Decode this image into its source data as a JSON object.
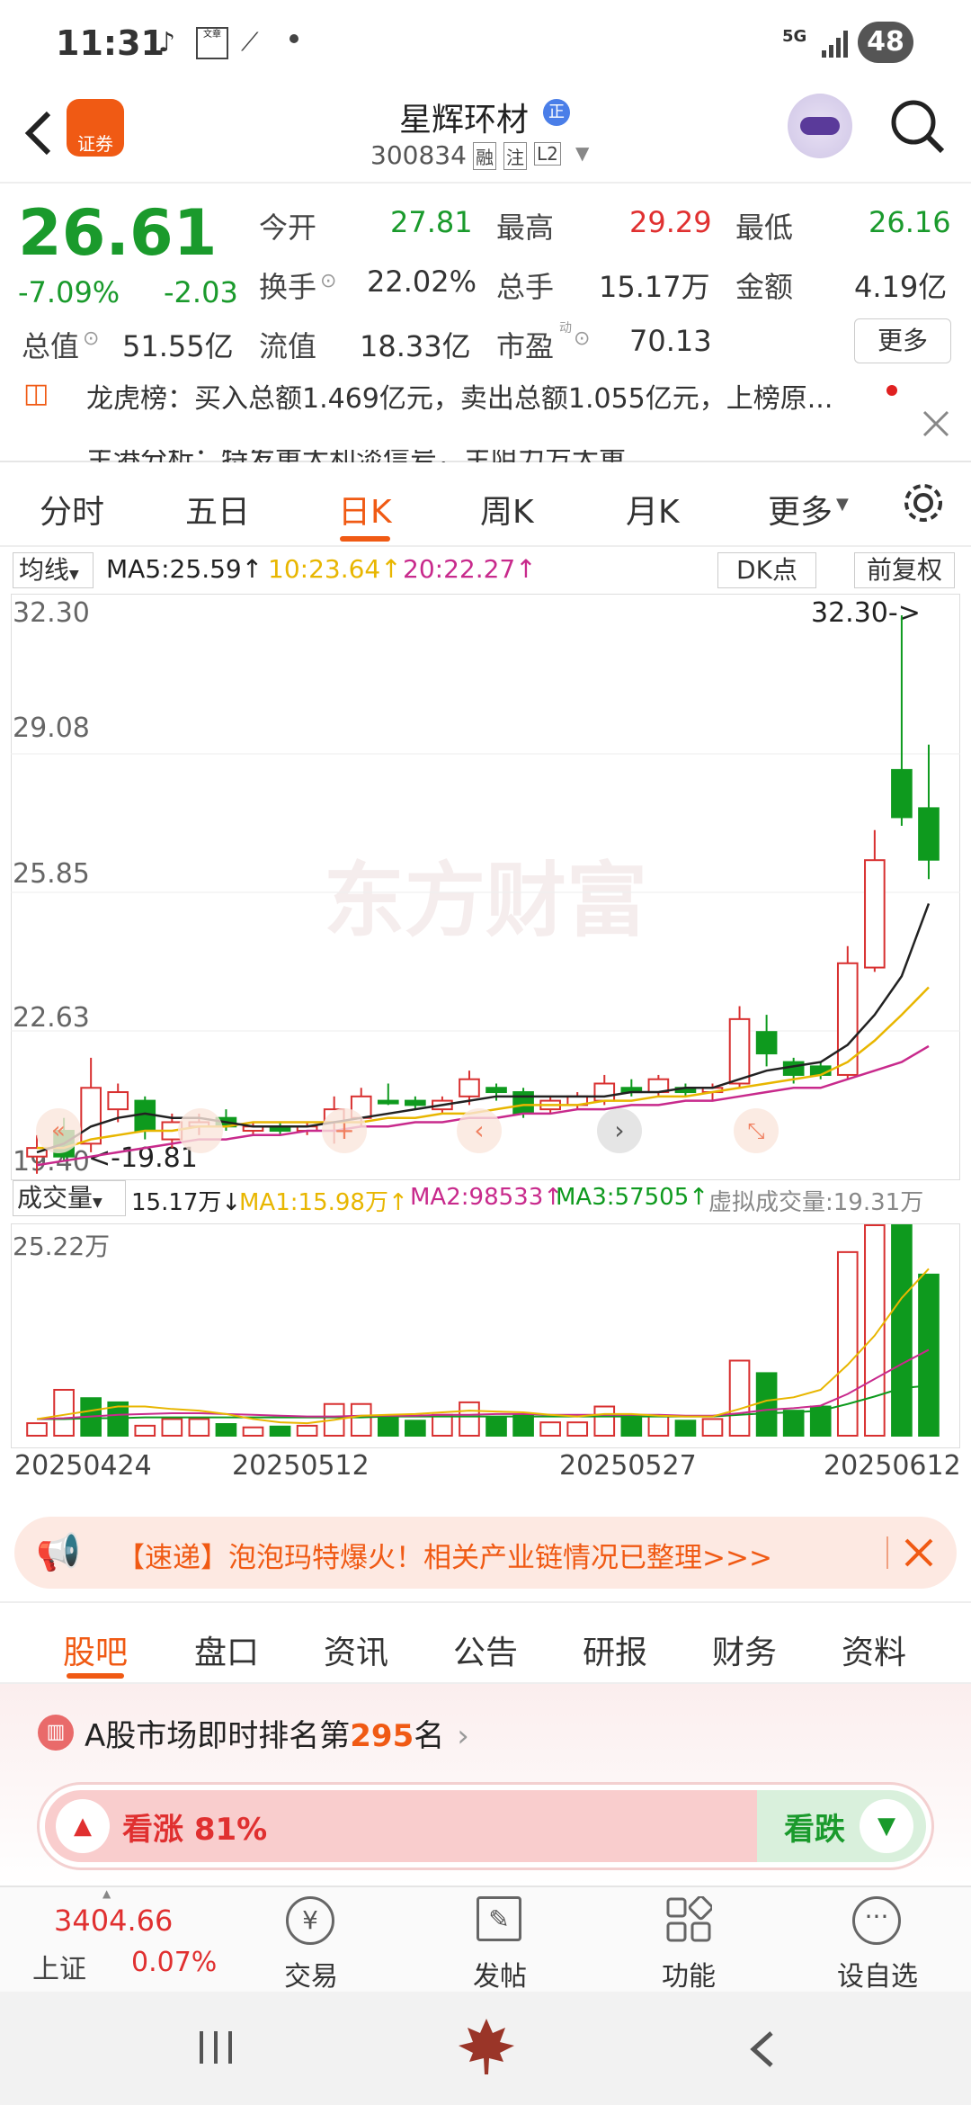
{
  "status_bar": {
    "time": "11:31",
    "network": "5G",
    "battery": "48"
  },
  "header": {
    "logo_label": "证券",
    "stock_name": "星辉环材",
    "stock_code": "300834",
    "tags": [
      "融",
      "注",
      "L2"
    ],
    "badge": "正"
  },
  "quote": {
    "price": "26.61",
    "change_pct": "-7.09%",
    "change_abs": "-2.03",
    "open_label": "今开",
    "open": "27.81",
    "high_label": "最高",
    "high": "29.29",
    "low_label": "最低",
    "low": "26.16",
    "turnover_label": "换手",
    "turnover": "22.02%",
    "volume_label": "总手",
    "volume": "15.17万",
    "amount_label": "金额",
    "amount": "4.19亿",
    "mktcap_label": "总值",
    "mktcap": "51.55亿",
    "float_label": "流值",
    "float_cap": "18.33亿",
    "pe_label": "市盈",
    "pe_sup": "动",
    "pe": "70.13",
    "more_label": "更多"
  },
  "news": {
    "dragon_tiger": "龙虎榜：买入总额1.469亿元，卖出总额1.055亿元，上榜原...",
    "second_line": "主港分析：特发重大利淡信号，主阻力方大重"
  },
  "kline_tabs": {
    "items": [
      "分时",
      "五日",
      "日K",
      "周K",
      "月K",
      "更多"
    ],
    "active": "日K"
  },
  "chart_toolbar": {
    "ma_select": "均线",
    "ma5": "MA5:25.59↑",
    "ma10": "10:23.64↑",
    "ma20": "20:22.27↑",
    "dk_button": "DK点",
    "adjust_button": "前复权"
  },
  "chart_data": {
    "type": "candlestick",
    "price_ticks": [
      "32.30",
      "29.08",
      "25.85",
      "22.63",
      "19.40"
    ],
    "ylim": [
      19.4,
      32.3
    ],
    "max_annotation": "32.30->",
    "min_annotation": "<-19.81",
    "watermark": "东方财富",
    "x_tick_labels": [
      "20250424",
      "20250512",
      "20250527",
      "20250612"
    ],
    "candles": [
      {
        "o": 19.9,
        "c": 19.7,
        "h": 20.2,
        "l": 19.3,
        "up": true
      },
      {
        "o": 19.7,
        "c": 20.3,
        "h": 20.6,
        "l": 19.6,
        "up": false
      },
      {
        "o": 20.0,
        "c": 21.3,
        "h": 22.0,
        "l": 19.8,
        "up": true
      },
      {
        "o": 20.8,
        "c": 21.2,
        "h": 21.4,
        "l": 20.5,
        "up": true
      },
      {
        "o": 21.0,
        "c": 20.3,
        "h": 21.1,
        "l": 20.1,
        "up": false
      },
      {
        "o": 20.1,
        "c": 20.5,
        "h": 20.7,
        "l": 19.9,
        "up": true
      },
      {
        "o": 20.4,
        "c": 20.5,
        "h": 20.7,
        "l": 20.2,
        "up": true
      },
      {
        "o": 20.6,
        "c": 20.4,
        "h": 20.8,
        "l": 20.3,
        "up": false
      },
      {
        "o": 20.3,
        "c": 20.4,
        "h": 20.5,
        "l": 20.2,
        "up": true
      },
      {
        "o": 20.4,
        "c": 20.3,
        "h": 20.5,
        "l": 20.2,
        "up": false
      },
      {
        "o": 20.3,
        "c": 20.4,
        "h": 20.5,
        "l": 20.2,
        "up": true
      },
      {
        "o": 20.5,
        "c": 20.8,
        "h": 21.1,
        "l": 20.0,
        "up": true
      },
      {
        "o": 20.6,
        "c": 21.1,
        "h": 21.3,
        "l": 20.4,
        "up": true
      },
      {
        "o": 21.0,
        "c": 21.0,
        "h": 21.4,
        "l": 20.9,
        "up": false
      },
      {
        "o": 21.0,
        "c": 20.9,
        "h": 21.1,
        "l": 20.8,
        "up": false
      },
      {
        "o": 20.8,
        "c": 21.0,
        "h": 21.1,
        "l": 20.7,
        "up": true
      },
      {
        "o": 21.1,
        "c": 21.5,
        "h": 21.7,
        "l": 20.9,
        "up": true
      },
      {
        "o": 21.3,
        "c": 21.2,
        "h": 21.4,
        "l": 21.0,
        "up": false
      },
      {
        "o": 21.2,
        "c": 20.7,
        "h": 21.3,
        "l": 20.6,
        "up": false
      },
      {
        "o": 20.8,
        "c": 21.0,
        "h": 21.1,
        "l": 20.7,
        "up": true
      },
      {
        "o": 20.9,
        "c": 21.1,
        "h": 21.2,
        "l": 20.8,
        "up": true
      },
      {
        "o": 21.0,
        "c": 21.4,
        "h": 21.6,
        "l": 20.9,
        "up": true
      },
      {
        "o": 21.3,
        "c": 21.2,
        "h": 21.5,
        "l": 21.1,
        "up": false
      },
      {
        "o": 21.2,
        "c": 21.5,
        "h": 21.6,
        "l": 21.1,
        "up": true
      },
      {
        "o": 21.3,
        "c": 21.2,
        "h": 21.4,
        "l": 21.1,
        "up": false
      },
      {
        "o": 21.2,
        "c": 21.3,
        "h": 21.4,
        "l": 21.0,
        "up": true
      },
      {
        "o": 21.4,
        "c": 22.9,
        "h": 23.2,
        "l": 21.3,
        "up": true
      },
      {
        "o": 22.6,
        "c": 22.1,
        "h": 23.0,
        "l": 21.8,
        "up": false
      },
      {
        "o": 21.9,
        "c": 21.6,
        "h": 22.0,
        "l": 21.4,
        "up": false
      },
      {
        "o": 21.6,
        "c": 21.8,
        "h": 21.9,
        "l": 21.5,
        "up": false
      },
      {
        "o": 21.6,
        "c": 24.2,
        "h": 24.6,
        "l": 21.5,
        "up": true
      },
      {
        "o": 24.1,
        "c": 26.6,
        "h": 27.3,
        "l": 24.0,
        "up": true
      },
      {
        "o": 28.7,
        "c": 27.6,
        "h": 32.3,
        "l": 27.4,
        "up": false
      },
      {
        "o": 27.81,
        "c": 26.61,
        "h": 29.29,
        "l": 26.16,
        "up": false
      }
    ],
    "ma5": [
      19.8,
      20.0,
      20.4,
      20.6,
      20.7,
      20.6,
      20.6,
      20.5,
      20.4,
      20.4,
      20.4,
      20.5,
      20.6,
      20.7,
      20.8,
      20.9,
      21.0,
      21.1,
      21.1,
      21.1,
      21.1,
      21.1,
      21.2,
      21.2,
      21.3,
      21.3,
      21.5,
      21.7,
      21.8,
      21.9,
      22.3,
      23.0,
      23.9,
      25.59
    ],
    "ma10": [
      19.9,
      19.9,
      20.1,
      20.2,
      20.3,
      20.3,
      20.4,
      20.4,
      20.5,
      20.5,
      20.5,
      20.5,
      20.5,
      20.6,
      20.6,
      20.7,
      20.7,
      20.8,
      20.9,
      20.9,
      20.9,
      21.0,
      21.0,
      21.1,
      21.1,
      21.2,
      21.3,
      21.4,
      21.5,
      21.6,
      21.9,
      22.4,
      23.0,
      23.64
    ],
    "ma20": [
      19.5,
      19.6,
      19.7,
      19.8,
      19.9,
      20.0,
      20.1,
      20.1,
      20.2,
      20.2,
      20.3,
      20.3,
      20.4,
      20.4,
      20.5,
      20.5,
      20.6,
      20.6,
      20.7,
      20.7,
      20.8,
      20.8,
      20.9,
      20.9,
      21.0,
      21.0,
      21.1,
      21.2,
      21.3,
      21.3,
      21.5,
      21.7,
      21.9,
      22.27
    ]
  },
  "volume": {
    "select_label": "成交量",
    "vol_value": "15.17万↓",
    "ma1": "MA1:15.98万↑",
    "ma2": "MA2:98533↑",
    "ma3": "MA3:57505↑",
    "virtual": "虚拟成交量:19.31万",
    "top_tick": "25.22万",
    "ylim": [
      0,
      25.22
    ],
    "bars": [
      1.5,
      5.5,
      4.5,
      4.0,
      1.2,
      2.0,
      2.0,
      1.4,
      1.0,
      1.1,
      1.2,
      3.8,
      3.8,
      2.3,
      1.8,
      2.5,
      4.0,
      2.2,
      2.5,
      1.6,
      1.6,
      3.5,
      2.3,
      2.4,
      1.8,
      2.0,
      9.0,
      7.5,
      3.0,
      3.5,
      22.0,
      25.22,
      25.22,
      19.31
    ],
    "colors_up": [
      true,
      true,
      false,
      false,
      true,
      true,
      true,
      false,
      true,
      false,
      true,
      true,
      true,
      false,
      false,
      true,
      true,
      false,
      false,
      true,
      true,
      true,
      false,
      true,
      false,
      true,
      true,
      false,
      false,
      false,
      true,
      true,
      false,
      false
    ],
    "ma1_line": [
      2,
      2.5,
      3,
      3.5,
      3.5,
      3.2,
      3.0,
      2.6,
      2.0,
      1.6,
      1.5,
      1.9,
      2.4,
      2.5,
      2.6,
      2.8,
      3.0,
      2.9,
      2.8,
      2.5,
      2.3,
      2.6,
      2.6,
      2.4,
      2.3,
      2.3,
      3.2,
      4.2,
      4.6,
      5.5,
      8.5,
      12,
      16.5,
      20
    ],
    "ma2_line": [
      2,
      2.1,
      2.3,
      2.5,
      2.6,
      2.7,
      2.7,
      2.6,
      2.5,
      2.4,
      2.3,
      2.3,
      2.4,
      2.4,
      2.4,
      2.5,
      2.5,
      2.6,
      2.6,
      2.5,
      2.5,
      2.5,
      2.5,
      2.5,
      2.4,
      2.4,
      2.7,
      3.1,
      3.3,
      3.6,
      5.0,
      6.8,
      8.6,
      10.3
    ],
    "ma3_line": [
      2,
      2.0,
      2.1,
      2.1,
      2.2,
      2.2,
      2.2,
      2.2,
      2.2,
      2.2,
      2.2,
      2.2,
      2.2,
      2.3,
      2.3,
      2.3,
      2.3,
      2.3,
      2.3,
      2.3,
      2.3,
      2.3,
      2.3,
      2.3,
      2.3,
      2.3,
      2.5,
      2.7,
      2.8,
      3.0,
      3.8,
      4.7,
      5.7,
      6.0
    ]
  },
  "promo": {
    "text": "【速递】泡泡玛特爆火！相关产业链情况已整理>>>"
  },
  "guba_tabs": {
    "items": [
      "股吧",
      "盘口",
      "资讯",
      "公告",
      "研报",
      "财务",
      "资料"
    ],
    "active": "股吧"
  },
  "ranking": {
    "prefix": "A股市场即时排名第",
    "rank": "295",
    "suffix": "名",
    "bull_label": "看涨 81%",
    "bear_label": "看跌",
    "bull_pct": 81
  },
  "bottom_bar": {
    "index_value": "3404.66",
    "index_name": "上证",
    "index_change": "0.07%",
    "items": [
      "交易",
      "发帖",
      "功能",
      "设自选"
    ]
  },
  "colors": {
    "up": "#d83030",
    "down": "#0e9a1e",
    "accent": "#f05a14",
    "ma5": "#222222",
    "ma10": "#e8b600",
    "ma20": "#c82a8c"
  }
}
